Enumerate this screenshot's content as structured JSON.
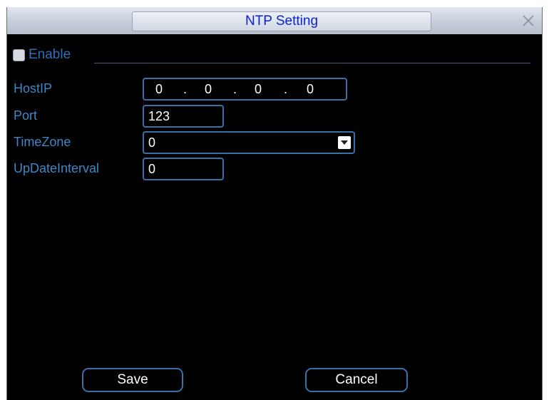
{
  "window": {
    "title": "NTP Setting"
  },
  "form": {
    "enable_label": "Enable",
    "enable_checked": false,
    "hostip_label": "HostIP",
    "hostip": [
      "0",
      "0",
      "0",
      "0"
    ],
    "hostip_separator": ".",
    "port_label": "Port",
    "port_value": "123",
    "timezone_label": "TimeZone",
    "timezone_value": "0",
    "updateinterval_label": "UpDateInterval",
    "updateinterval_value": "0"
  },
  "buttons": {
    "save_label": "Save",
    "cancel_label": "Cancel"
  },
  "colors": {
    "label_blue": "#3e87c8",
    "title_blue": "#0b1fd6",
    "field_border": "#3a70a8",
    "background": "#000000"
  },
  "icons": {
    "close": "close-x-icon",
    "dropdown": "chevron-down-icon"
  }
}
